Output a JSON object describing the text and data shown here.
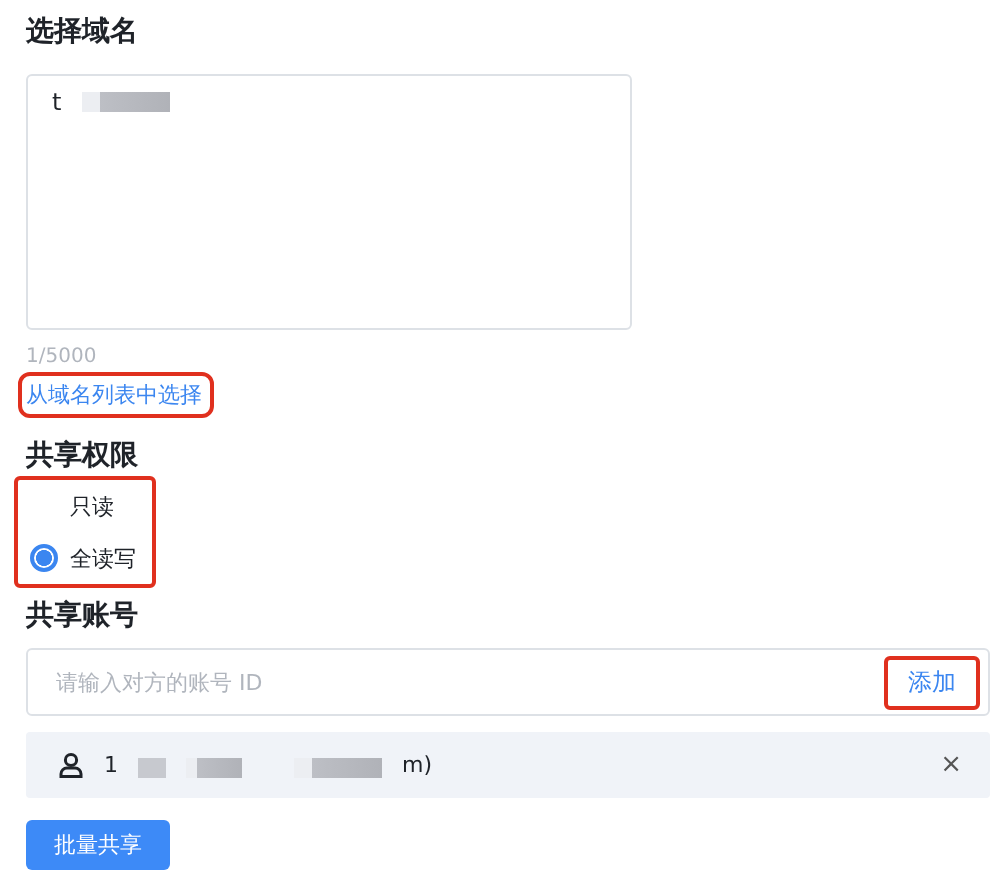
{
  "domain_section": {
    "title": "选择域名",
    "textarea": {
      "value": "t"
    },
    "counter": "1/5000",
    "link": {
      "label": "从域名列表中选择",
      "highlighted": true
    }
  },
  "permission_section": {
    "title": "共享权限",
    "highlighted": true,
    "options": [
      {
        "label": "只读",
        "selected": false
      },
      {
        "label": "全读写",
        "selected": true
      }
    ]
  },
  "account_section": {
    "title": "共享账号",
    "input": {
      "placeholder": "请输入对方的账号 ID"
    },
    "add_button": {
      "label": "添加",
      "highlighted": true
    },
    "accounts": [
      {
        "prefix": "1",
        "suffix": "m)",
        "remove": "×"
      }
    ]
  },
  "submit_button": "批量共享"
}
